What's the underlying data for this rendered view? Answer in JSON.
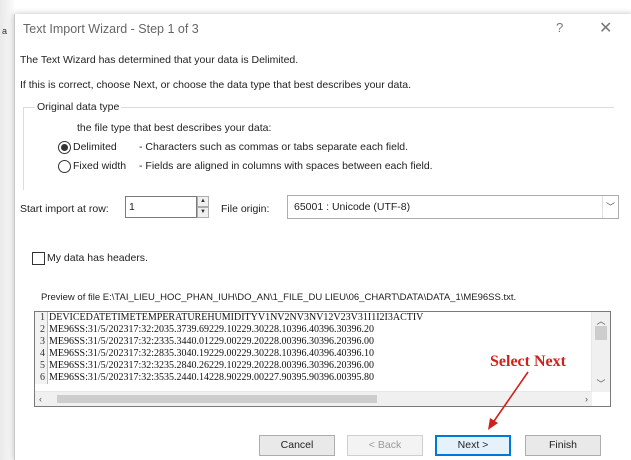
{
  "left_fragment": "a",
  "dialog": {
    "title": "Text Import Wizard - Step 1 of 3",
    "help_glyph": "?",
    "close_glyph": "✕",
    "line1": "The Text Wizard has determined that your data is Delimited.",
    "line2": "If this is correct, choose Next, or choose the data type that best describes your data.",
    "group_label": "Original data type",
    "group_prompt": "the file type that best describes your data:",
    "options": [
      {
        "label": "Delimited",
        "desc": "- Characters such as commas or tabs separate each field.",
        "selected": true
      },
      {
        "label": "Fixed width",
        "desc": "- Fields are aligned in columns with spaces between each field.",
        "selected": false
      }
    ],
    "start_row_label": "Start import at row:",
    "start_row_value": "1",
    "file_origin_label": "File origin:",
    "file_origin_value": "65001 : Unicode (UTF-8)",
    "headers_label": "My data has headers.",
    "headers_checked": false,
    "preview_label": "Preview of file E:\\TAI_LIEU_HOC_PHAN_IUH\\DO_AN\\1_FILE_DU LIEU\\06_CHART\\DATA\\DATA_1\\ME96SS.txt.",
    "preview_rows": [
      {
        "num": "1",
        "text": "DEVICEDATETIMETEMPERATUREHUMIDITYV1NV2NV3NV12V23V31I1I2I3ACTIV"
      },
      {
        "num": "2",
        "text": "ME96SS:31/5/202317:32:2035.3739.69229.10229.30228.10396.40396.30396.20"
      },
      {
        "num": "3",
        "text": "ME96SS:31/5/202317:32:2335.3440.01229.00229.20228.00396.30396.20396.00"
      },
      {
        "num": "4",
        "text": "ME96SS:31/5/202317:32:2835.3040.19229.00229.30228.10396.40396.40396.10"
      },
      {
        "num": "5",
        "text": "ME96SS:31/5/202317:32:3235.2840.26229.10229.20228.00396.30396.20396.00"
      },
      {
        "num": "6",
        "text": "ME96SS:31/5/202317:32:3535.2440.14228.90229.00227.90395.90396.00395.80"
      }
    ],
    "buttons": {
      "cancel": "Cancel",
      "back": "< Back",
      "next": "Next >",
      "finish": "Finish"
    }
  },
  "annotation": {
    "text": "Select Next",
    "color": "#d0201c"
  },
  "icons": [
    "radio-icon",
    "spin-up-icon",
    "spin-down-icon",
    "chevron-down-icon",
    "checkbox-icon",
    "scroll-arrows"
  ]
}
